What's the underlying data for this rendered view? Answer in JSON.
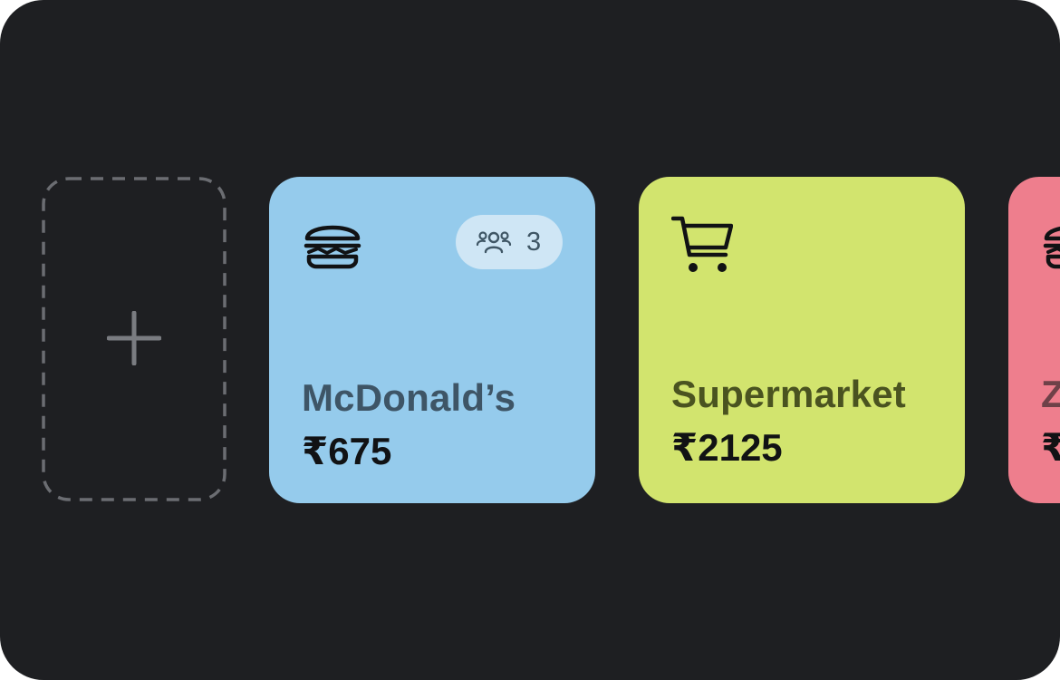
{
  "add_tile": {
    "icon": "plus-icon"
  },
  "cards": [
    {
      "title": "McDonald’s",
      "amount": "₹675",
      "icon": "burger-icon",
      "members_count": "3",
      "members_icon": "group-icon",
      "background": "#95cbec",
      "title_color": "#3e5566"
    },
    {
      "title": "Supermarket",
      "amount": "₹2125",
      "icon": "cart-icon",
      "background": "#d2e46e",
      "title_color": "#4a5320"
    },
    {
      "title": "Z",
      "amount": "₹",
      "icon": "burger-icon",
      "background": "#ee7e8d",
      "title_color": "#6e4148"
    }
  ],
  "colors": {
    "screen_background": "#1e1f22",
    "dashed_border": "#6b6d72",
    "plus": "#7a7c81"
  }
}
